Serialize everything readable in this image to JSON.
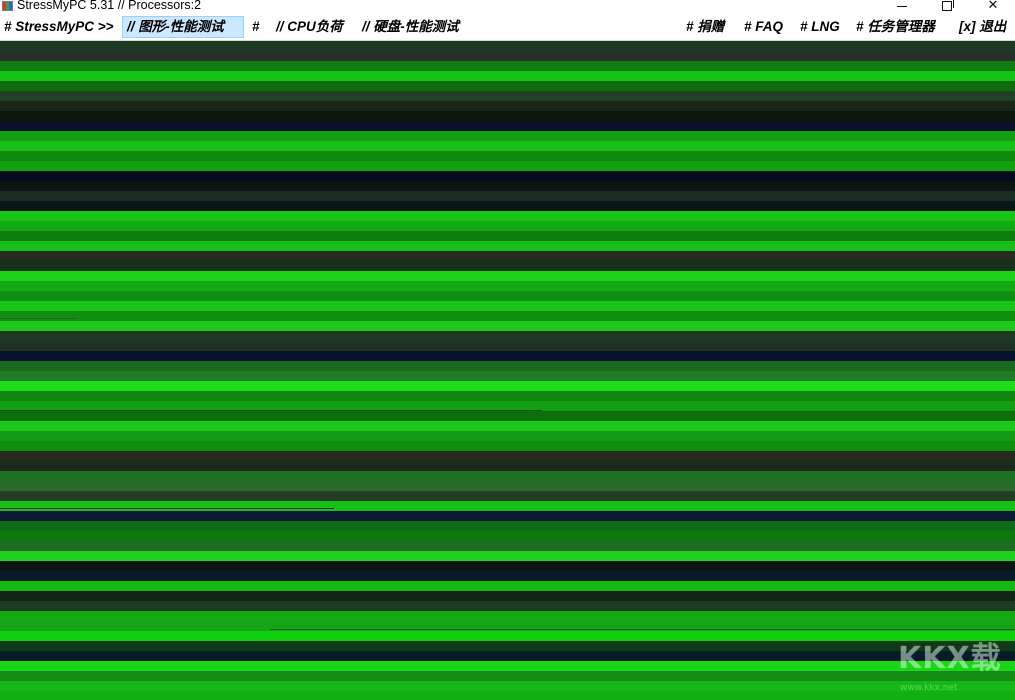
{
  "window": {
    "title": "StressMyPC 5.31 // Processors:2",
    "controls": {
      "minimize": "minimize",
      "maximize": "maximize",
      "close": "✕"
    }
  },
  "menu": {
    "brand": "# StressMyPC >>",
    "graphics": "// 图形-性能测试",
    "hash": "#",
    "cpu": "// CPU负荷",
    "disk": "// 硬盘-性能测试",
    "donate": "# 捐赠",
    "faq": "# FAQ",
    "lng": "# LNG",
    "taskmgr": "# 任务管理器",
    "exit": "[x] 退出"
  },
  "render": {
    "stripes": [
      {
        "h": 10,
        "c": "#1e3a22"
      },
      {
        "h": 10,
        "c": "#2b2f2a"
      },
      {
        "h": 10,
        "c": "#0f7d10"
      },
      {
        "h": 10,
        "c": "#16c216"
      },
      {
        "h": 10,
        "c": "#0c6e0c"
      },
      {
        "h": 10,
        "c": "#233f26"
      },
      {
        "h": 10,
        "c": "#1a2417"
      },
      {
        "h": 10,
        "c": "#0c180a"
      },
      {
        "h": 10,
        "c": "#07112a"
      },
      {
        "h": 10,
        "c": "#129e12"
      },
      {
        "h": 10,
        "c": "#17bf17"
      },
      {
        "h": 10,
        "c": "#0f8a0f"
      },
      {
        "h": 10,
        "c": "#10a010"
      },
      {
        "h": 10,
        "c": "#050d20"
      },
      {
        "h": 10,
        "c": "#0c1611"
      },
      {
        "h": 10,
        "c": "#1b2d20"
      },
      {
        "h": 10,
        "c": "#0b1717"
      },
      {
        "h": 10,
        "c": "#19c419"
      },
      {
        "h": 10,
        "c": "#12aa12"
      },
      {
        "h": 10,
        "c": "#0e7d0e"
      },
      {
        "h": 10,
        "c": "#18bd18"
      },
      {
        "h": 10,
        "c": "#262b1e"
      },
      {
        "h": 10,
        "c": "#173118"
      },
      {
        "h": 10,
        "c": "#1dd21d"
      },
      {
        "h": 10,
        "c": "#14a914"
      },
      {
        "h": 10,
        "c": "#0f8f0f"
      },
      {
        "h": 10,
        "c": "#1bc61b"
      },
      {
        "h": 10,
        "c": "#0e8d0e"
      },
      {
        "h": 10,
        "c": "#1ec71e"
      },
      {
        "h": 10,
        "c": "#1f3824"
      },
      {
        "h": 10,
        "c": "#1f3123"
      },
      {
        "h": 10,
        "c": "#07122c"
      },
      {
        "h": 10,
        "c": "#186b1d"
      },
      {
        "h": 10,
        "c": "#227a27"
      },
      {
        "h": 10,
        "c": "#1adc1a"
      },
      {
        "h": 10,
        "c": "#0f860f"
      },
      {
        "h": 10,
        "c": "#149e14"
      },
      {
        "h": 10,
        "c": "#0c6f0c"
      },
      {
        "h": 10,
        "c": "#1cc61c"
      },
      {
        "h": 10,
        "c": "#129a12"
      },
      {
        "h": 10,
        "c": "#0e900e"
      },
      {
        "h": 10,
        "c": "#272a1f"
      },
      {
        "h": 10,
        "c": "#1a2a1e"
      },
      {
        "h": 10,
        "c": "#1d6f22"
      },
      {
        "h": 10,
        "c": "#2a6b2c"
      },
      {
        "h": 10,
        "c": "#233d27"
      },
      {
        "h": 10,
        "c": "#17c017"
      },
      {
        "h": 10,
        "c": "#0a1a32"
      },
      {
        "h": 10,
        "c": "#116c16"
      },
      {
        "h": 10,
        "c": "#0d790d"
      },
      {
        "h": 10,
        "c": "#1f6d25"
      },
      {
        "h": 10,
        "c": "#1fd01f"
      },
      {
        "h": 10,
        "c": "#0a1410"
      },
      {
        "h": 10,
        "c": "#0b1a28"
      },
      {
        "h": 10,
        "c": "#14b714"
      },
      {
        "h": 10,
        "c": "#112417"
      },
      {
        "h": 10,
        "c": "#1e3a22"
      },
      {
        "h": 10,
        "c": "#13a913"
      },
      {
        "h": 10,
        "c": "#15a415"
      },
      {
        "h": 10,
        "c": "#0fcf0f"
      },
      {
        "h": 10,
        "c": "#0f3a1a"
      },
      {
        "h": 10,
        "c": "#081b28"
      },
      {
        "h": 10,
        "c": "#19d619"
      },
      {
        "h": 10,
        "c": "#138c13"
      },
      {
        "h": 10,
        "c": "#16b816"
      },
      {
        "h": 10,
        "c": "#10b010"
      }
    ]
  },
  "watermark": {
    "text": "KKX载",
    "subtext": "www.kkx.net"
  }
}
